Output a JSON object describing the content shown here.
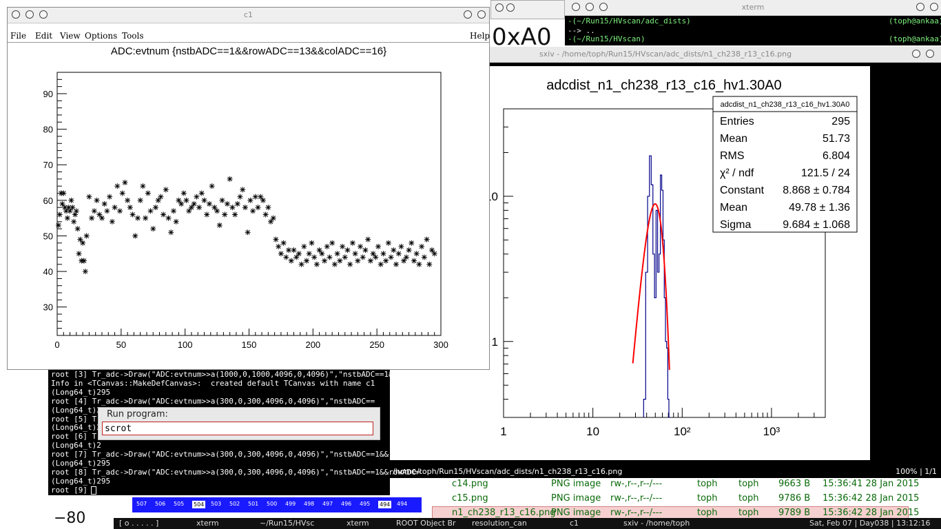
{
  "c1": {
    "title": "c1",
    "menu": [
      "File",
      "Edit",
      "View",
      "Options",
      "Tools",
      "Help"
    ]
  },
  "chart_data": [
    {
      "type": "scatter",
      "title": "ADC:evtnum {nstbADC==1&&rowADC==13&&colADC==16}",
      "xlabel": "",
      "ylabel": "",
      "xlim": [
        0,
        300
      ],
      "ylim": [
        22,
        96
      ],
      "xticks": [
        "0",
        "50",
        "100",
        "150",
        "200",
        "250",
        "300"
      ],
      "yticks": [
        "30",
        "40",
        "50",
        "60",
        "70",
        "80",
        "90"
      ],
      "marker": "star",
      "seed_segments": [
        {
          "x0": 0,
          "x1": 25,
          "mean": 56,
          "spread": 6
        },
        {
          "x0": 25,
          "x1": 170,
          "mean": 57,
          "spread": 5
        },
        {
          "x0": 170,
          "x1": 296,
          "mean": 45,
          "spread": 3
        }
      ],
      "points": [
        [
          1,
          53
        ],
        [
          2,
          56
        ],
        [
          3,
          62
        ],
        [
          4,
          59
        ],
        [
          5,
          62
        ],
        [
          6,
          58
        ],
        [
          7,
          57
        ],
        [
          8,
          55
        ],
        [
          9,
          58
        ],
        [
          10,
          57
        ],
        [
          11,
          60
        ],
        [
          12,
          58
        ],
        [
          13,
          54
        ],
        [
          14,
          56
        ],
        [
          15,
          57
        ],
        [
          16,
          52
        ],
        [
          17,
          45
        ],
        [
          18,
          49
        ],
        [
          19,
          43
        ],
        [
          20,
          48
        ],
        [
          21,
          43
        ],
        [
          22,
          40
        ],
        [
          23,
          50
        ],
        [
          25,
          61
        ],
        [
          27,
          55
        ],
        [
          29,
          57
        ],
        [
          31,
          60
        ],
        [
          33,
          56
        ],
        [
          35,
          55
        ],
        [
          37,
          59
        ],
        [
          39,
          57
        ],
        [
          41,
          61
        ],
        [
          43,
          54
        ],
        [
          45,
          58
        ],
        [
          47,
          64
        ],
        [
          49,
          57
        ],
        [
          51,
          62
        ],
        [
          53,
          65
        ],
        [
          55,
          60
        ],
        [
          57,
          58
        ],
        [
          59,
          56
        ],
        [
          61,
          50
        ],
        [
          63,
          55
        ],
        [
          65,
          60
        ],
        [
          67,
          64
        ],
        [
          69,
          55
        ],
        [
          71,
          62
        ],
        [
          73,
          57
        ],
        [
          75,
          52
        ],
        [
          77,
          58
        ],
        [
          79,
          60
        ],
        [
          81,
          61
        ],
        [
          83,
          56
        ],
        [
          85,
          63
        ],
        [
          87,
          55
        ],
        [
          89,
          51
        ],
        [
          91,
          57
        ],
        [
          93,
          54
        ],
        [
          95,
          60
        ],
        [
          97,
          59
        ],
        [
          99,
          62
        ],
        [
          101,
          60
        ],
        [
          103,
          57
        ],
        [
          105,
          58
        ],
        [
          107,
          59
        ],
        [
          109,
          61
        ],
        [
          111,
          58
        ],
        [
          113,
          62
        ],
        [
          115,
          60
        ],
        [
          117,
          56
        ],
        [
          119,
          59
        ],
        [
          121,
          64
        ],
        [
          123,
          58
        ],
        [
          125,
          57
        ],
        [
          127,
          53
        ],
        [
          129,
          60
        ],
        [
          131,
          56
        ],
        [
          133,
          59
        ],
        [
          135,
          66
        ],
        [
          137,
          58
        ],
        [
          139,
          56
        ],
        [
          141,
          59
        ],
        [
          143,
          61
        ],
        [
          145,
          63
        ],
        [
          147,
          58
        ],
        [
          149,
          51
        ],
        [
          151,
          60
        ],
        [
          153,
          57
        ],
        [
          155,
          61
        ],
        [
          157,
          58
        ],
        [
          159,
          61
        ],
        [
          161,
          60
        ],
        [
          163,
          56
        ],
        [
          165,
          58
        ],
        [
          167,
          54
        ],
        [
          169,
          55
        ],
        [
          171,
          49
        ],
        [
          173,
          47
        ],
        [
          175,
          45
        ],
        [
          177,
          48
        ],
        [
          179,
          44
        ],
        [
          181,
          46
        ],
        [
          183,
          43
        ],
        [
          185,
          46
        ],
        [
          187,
          44
        ],
        [
          189,
          45
        ],
        [
          191,
          42
        ],
        [
          193,
          47
        ],
        [
          195,
          43
        ],
        [
          197,
          45
        ],
        [
          199,
          48
        ],
        [
          201,
          44
        ],
        [
          203,
          42
        ],
        [
          205,
          46
        ],
        [
          207,
          45
        ],
        [
          209,
          43
        ],
        [
          211,
          47
        ],
        [
          213,
          44
        ],
        [
          215,
          48
        ],
        [
          217,
          42
        ],
        [
          219,
          45
        ],
        [
          221,
          43
        ],
        [
          223,
          47
        ],
        [
          225,
          44
        ],
        [
          227,
          46
        ],
        [
          229,
          42
        ],
        [
          231,
          48
        ],
        [
          233,
          45
        ],
        [
          235,
          43
        ],
        [
          237,
          47
        ],
        [
          239,
          44
        ],
        [
          241,
          46
        ],
        [
          243,
          49
        ],
        [
          245,
          43
        ],
        [
          247,
          45
        ],
        [
          249,
          44
        ],
        [
          251,
          47
        ],
        [
          253,
          42
        ],
        [
          255,
          45
        ],
        [
          257,
          43
        ],
        [
          259,
          48
        ],
        [
          261,
          44
        ],
        [
          263,
          46
        ],
        [
          265,
          42
        ],
        [
          267,
          45
        ],
        [
          269,
          47
        ],
        [
          271,
          43
        ],
        [
          273,
          44
        ],
        [
          275,
          46
        ],
        [
          277,
          48
        ],
        [
          279,
          43
        ],
        [
          281,
          45
        ],
        [
          283,
          42
        ],
        [
          285,
          47
        ],
        [
          287,
          44
        ],
        [
          289,
          49
        ],
        [
          291,
          42
        ],
        [
          293,
          46
        ],
        [
          295,
          45
        ]
      ]
    },
    {
      "type": "line",
      "title": "adcdist_n1_ch238_r13_c16_hv1.30A0",
      "xscale": "log",
      "yscale": "log",
      "xlim": [
        1,
        4000
      ],
      "ylim": [
        0.3,
        40
      ],
      "xticks": [
        "1",
        "10",
        "10²",
        "10³"
      ],
      "yticks": [
        "10",
        "1"
      ],
      "histogram": {
        "x": [
          38,
          40,
          42,
          44,
          46,
          48,
          50,
          52,
          54,
          56,
          58,
          60,
          62,
          64,
          66,
          68,
          70,
          72
        ],
        "y": [
          0.4,
          3.0,
          10.0,
          19.0,
          12.0,
          4.0,
          2.0,
          8.0,
          3.0,
          4.0,
          14.0,
          11.0,
          5.0,
          2.0,
          1.0,
          0.9,
          0.4,
          0.3
        ]
      },
      "fit": {
        "type": "gaus",
        "constant": 8.868,
        "mean": 49.78,
        "sigma": 9.684
      },
      "stats_box": {
        "name": "adcdist_n1_ch238_r13_c16_hv1.30A0",
        "rows": [
          {
            "label": "Entries",
            "value": "295"
          },
          {
            "label": "Mean",
            "value": "51.73"
          },
          {
            "label": "RMS",
            "value": "6.804"
          },
          {
            "label": "χ² / ndf",
            "value": "121.5 / 24"
          },
          {
            "label": "Constant",
            "value": "8.868 ± 0.784"
          },
          {
            "label": "Mean",
            "value": "49.78 ± 1.36"
          },
          {
            "label": "Sigma",
            "value": "9.684 ± 1.068"
          }
        ]
      },
      "colors": {
        "histogram": "#00008b",
        "fit": "#ff0000"
      }
    }
  ],
  "xterm_top": {
    "title": "xterm",
    "line1": "-(~/Run15/HVscan/adc_dists)",
    "line1_right": "(toph@ankaa)",
    "line2": "--> ..",
    "line3": "-(~/Run15/HVscan)",
    "line3_right": "(toph@ankaa)"
  },
  "sxiv": {
    "title": "sxiv - /home/toph/Run15/HVscan/adc_dists/n1_ch238_r13_c16.png",
    "status_path": "/home/toph/Run15/HVscan/adc_dists/n1_ch238_r13_c16.png",
    "status_zoom": "100% | 1/1"
  },
  "terminal": {
    "lines": [
      "root [3] Tr_adc->Draw(\"ADC:evtnum>>a(1000,0,1000,4096,0,4096)\",\"nstbADC==1&&rowADC",
      "Info in <TCanvas::MakeDefCanvas>:  created default TCanvas with name c1",
      "(Long64_t)295",
      "root [4] Tr_adc->Draw(\"ADC:evtnum>>a(300,0,300,4096,0,4096)\",\"nstbADC==",
      "(Long64_t)295",
      "root [5] Tr",
      "(Long64_t)2",
      "root [6] Tr",
      "(Long64_t)2",
      "root [7] Tr_adc->Draw(\"ADC:evtnum>>a(300,0,300,4096,0,4096)\",\"nstbADC==1&&rowADC=",
      "(Long64_t)295",
      "root [8] Tr_adc->Draw(\"ADC:evtnum>>a(300,0,300,4096,0,4096)\",\"nstbADC==1&&rowADC=",
      "(Long64_t)295",
      "root [9] "
    ]
  },
  "run_dialog": {
    "label": "Run program:",
    "value": "scrot"
  },
  "file_list": [
    {
      "name": "c14.png",
      "type": "PNG image",
      "perms": "rw-,r--,r--/---",
      "owner": "toph",
      "group": "toph",
      "size": "9663 B",
      "time": "15:36:41 28 Jan 2015"
    },
    {
      "name": "c15.png",
      "type": "PNG image",
      "perms": "rw-,r--,r--/---",
      "owner": "toph",
      "group": "toph",
      "size": "9786 B",
      "time": "15:36:42 28 Jan 2015"
    },
    {
      "name": "n1_ch238_r13_c16.png",
      "type": "PNG image",
      "perms": "rw-,r--,r--/---",
      "owner": "toph",
      "group": "toph",
      "size": "9789 B",
      "time": "15:36:42 28 Jan 2015"
    }
  ],
  "bg_fragments": {
    "big_text": "0xA0",
    "tick_label": "−80",
    "strip_numbers": [
      "507",
      "506",
      "505",
      "504",
      "503",
      "502",
      "501",
      "500",
      "499",
      "498",
      "497",
      "496",
      "495",
      "494",
      "494"
    ]
  },
  "taskbar": {
    "workspace": "[ o . . . . . ]",
    "tasks": [
      "xterm",
      "~/Run15/HVsc",
      "xterm",
      "ROOT Object Br",
      "resolution_can",
      "c1",
      "sxiv - /home/toph"
    ],
    "clock": "Sat, Feb 07 | Day038 | 13:12:16"
  }
}
